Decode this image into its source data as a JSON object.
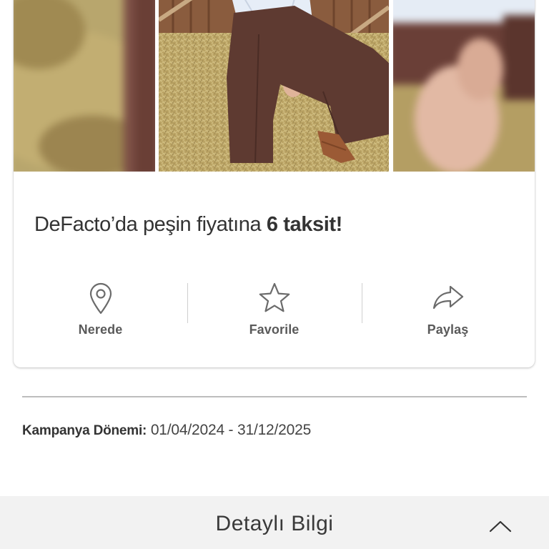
{
  "campaign": {
    "headline_regular": "DeFacto’da peşin fiyatına ",
    "headline_bold": "6 taksit!",
    "gallery_images": [
      "blurred-hay-closeup",
      "woman-sitting-on-hay-bale",
      "blurred-hand-closeup"
    ]
  },
  "actions": [
    {
      "label": "Nerede",
      "icon": "location-pin-icon"
    },
    {
      "label": "Favorile",
      "icon": "star-icon"
    },
    {
      "label": "Paylaş",
      "icon": "share-arrow-icon"
    }
  ],
  "period": {
    "label": "Kampanya Dönemi:",
    "value": " 01/04/2024 - 31/12/2025"
  },
  "details": {
    "title": "Detaylı Bilgi",
    "icon": "chevron-up-icon"
  },
  "colors": {
    "icon_gray": "#6b6b6b",
    "label_gray": "#5a5a5a",
    "details_bg": "#f2f2f2",
    "hay": "#b9a062",
    "trousers": "#5e3a31",
    "shirt": "#e8eef6"
  }
}
